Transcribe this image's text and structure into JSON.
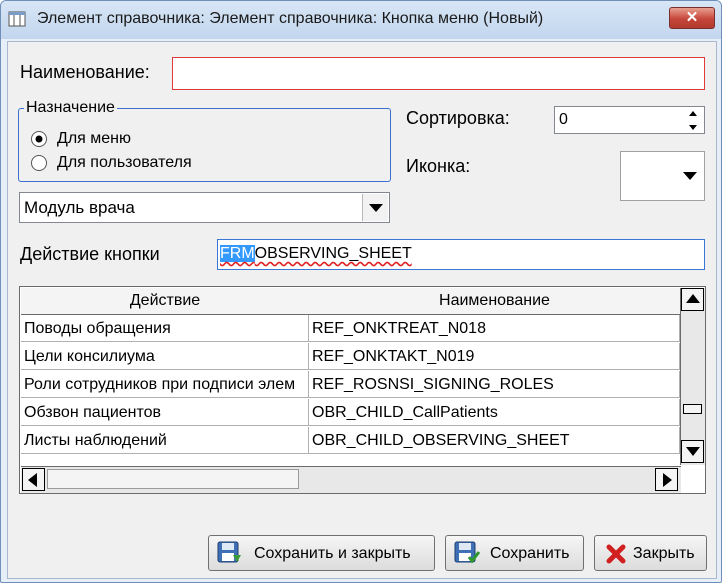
{
  "window": {
    "title": "Элемент справочника: Элемент справочника: Кнопка меню (Новый)",
    "close_symbol": "✕"
  },
  "form": {
    "name_label": "Наименование:",
    "name_value": "",
    "purpose_legend": "Назначение",
    "purpose_options": [
      {
        "label": "Для меню",
        "selected": true
      },
      {
        "label": "Для пользователя",
        "selected": false
      }
    ],
    "module_select": "Модуль врача",
    "sort_label": "Сортировка:",
    "sort_value": "0",
    "icon_label": "Иконка:",
    "action_label": "Действие кнопки",
    "action_value_selected": "FRM",
    "action_value_rest": "OBSERVING_SHEET"
  },
  "table": {
    "columns": [
      "Действие",
      "Наименование"
    ],
    "rows": [
      {
        "action": "Поводы обращения",
        "name": "REF_ONKTREAT_N018"
      },
      {
        "action": "Цели консилиума",
        "name": "REF_ONKTAKT_N019"
      },
      {
        "action": "Роли сотрудников при подписи элем",
        "name": "REF_ROSNSI_SIGNING_ROLES"
      },
      {
        "action": "Обзвон пациентов",
        "name": "OBR_CHILD_CallPatients"
      },
      {
        "action": "Листы наблюдений",
        "name": "OBR_CHILD_OBSERVING_SHEET"
      }
    ]
  },
  "buttons": {
    "save_close": "Сохранить и закрыть",
    "save": "Сохранить",
    "close": "Закрыть"
  },
  "colors": {
    "accent": "#3399ff",
    "error_border": "#e03a3a",
    "close_red": "#c6463a"
  }
}
